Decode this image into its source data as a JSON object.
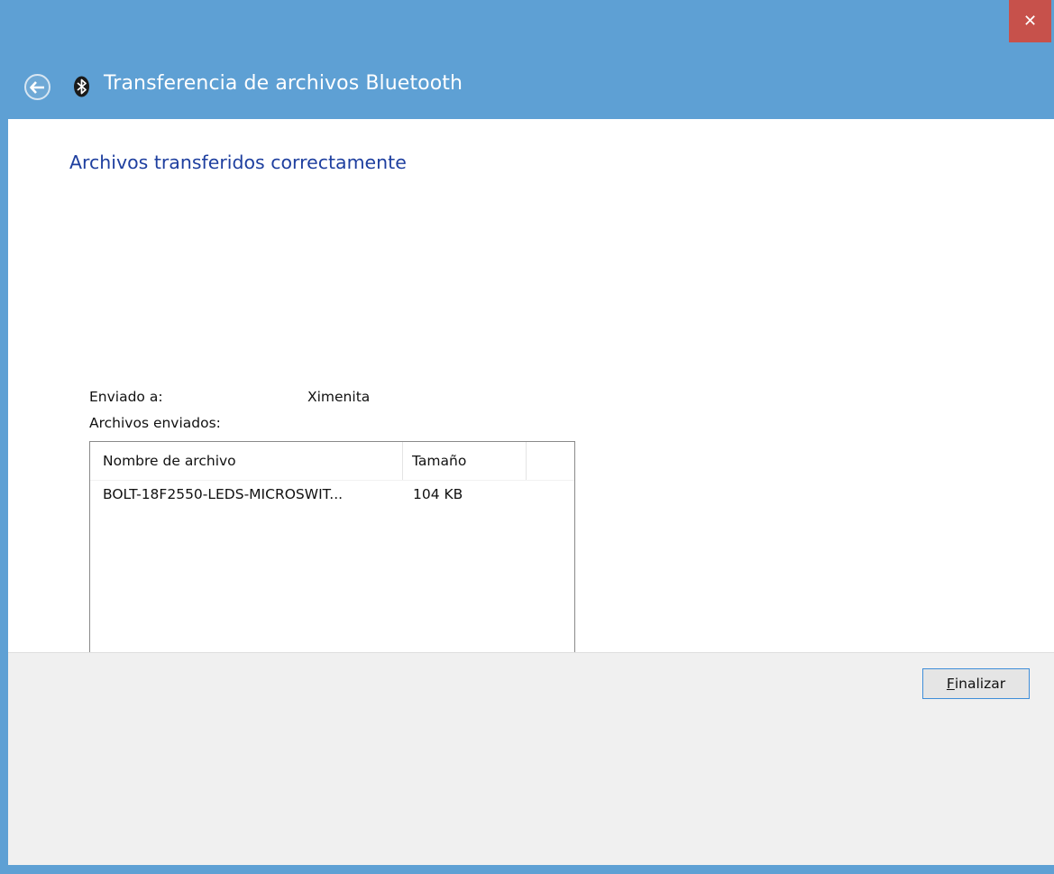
{
  "window": {
    "title": "Transferencia de archivos Bluetooth",
    "close_glyph": "✕"
  },
  "page": {
    "heading": "Archivos transferidos correctamente",
    "sent_to_label": "Enviado a:",
    "sent_to_value": "Ximenita",
    "files_sent_label": "Archivos enviados:"
  },
  "file_list": {
    "columns": [
      "Nombre de archivo",
      "Tamaño"
    ],
    "rows": [
      {
        "name": "BOLT-18F2550-LEDS-MICROSWIT...",
        "size": "104 KB"
      }
    ]
  },
  "footer": {
    "finish_accel": "F",
    "finish_rest": "inalizar"
  },
  "colors": {
    "titlebar": "#5ea0d4",
    "heading": "#1e3f9f",
    "close": "#c7514b"
  },
  "icons": {
    "back": "back-arrow-icon",
    "bluetooth": "bluetooth-icon",
    "close": "close-icon"
  }
}
